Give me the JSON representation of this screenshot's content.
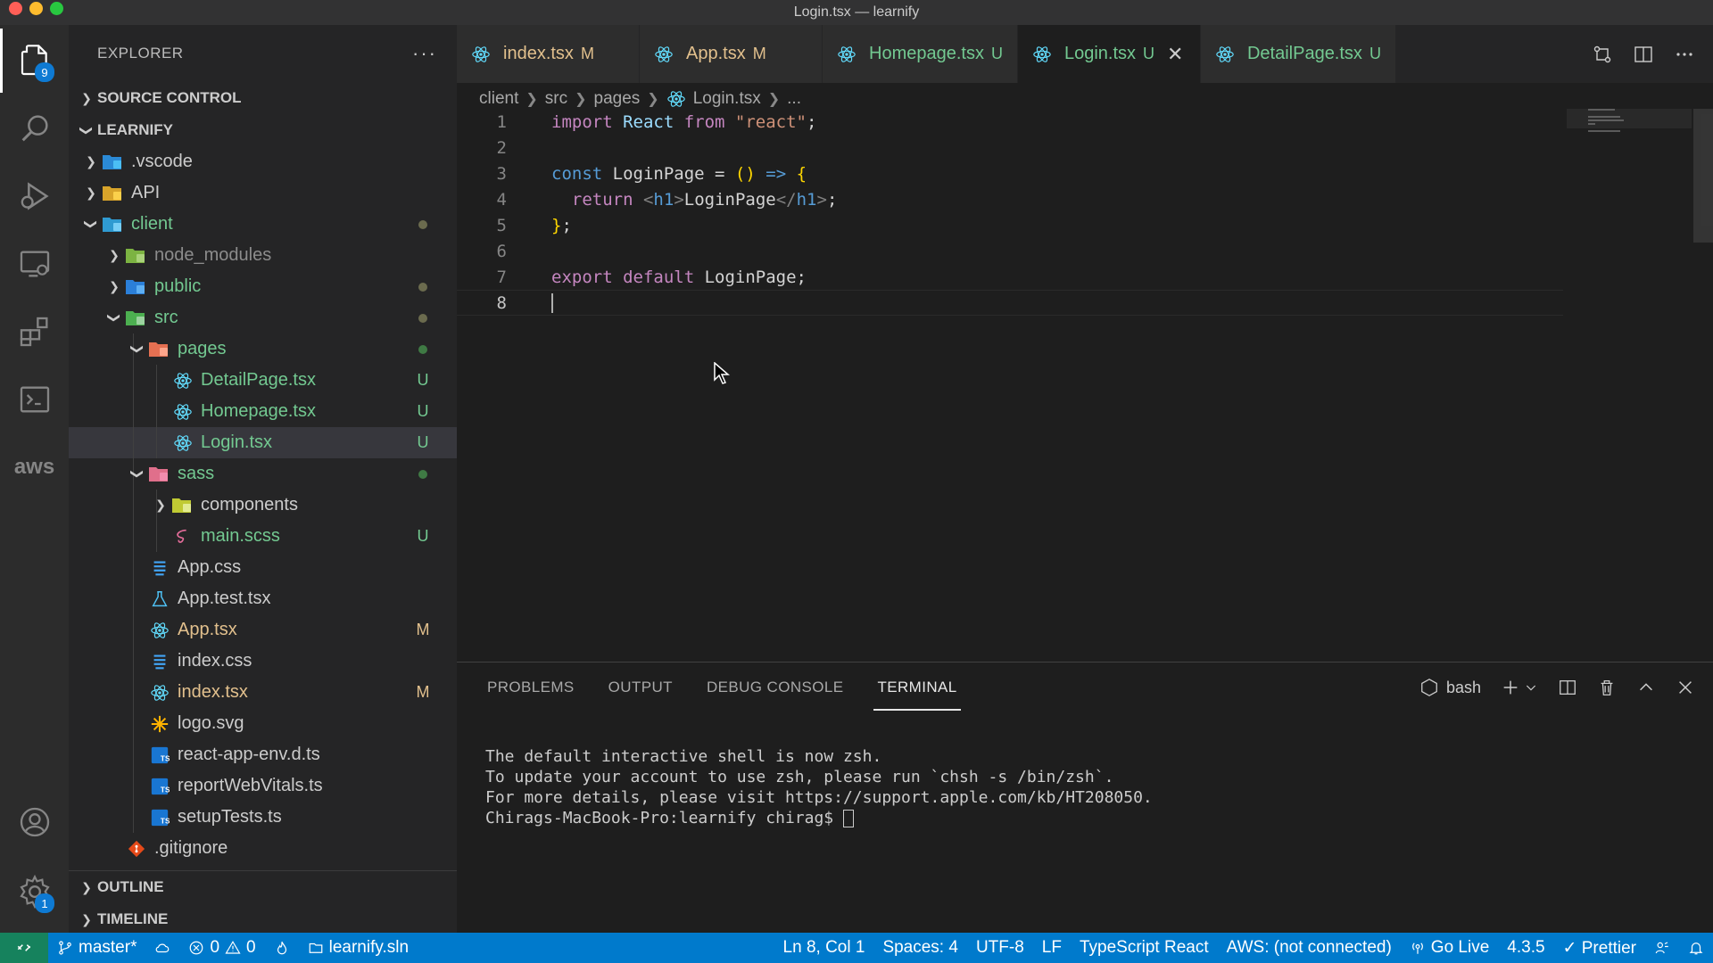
{
  "window": {
    "title": "Login.tsx — learnify"
  },
  "activity_bar": {
    "items": [
      {
        "name": "explorer",
        "badge": "9"
      },
      {
        "name": "search"
      },
      {
        "name": "run-debug"
      },
      {
        "name": "remote-explorer"
      },
      {
        "name": "extensions"
      },
      {
        "name": "terminal-view"
      },
      {
        "name": "aws",
        "label": "aws"
      }
    ],
    "accounts": {
      "name": "accounts"
    },
    "settings": {
      "name": "manage",
      "badge": "1"
    }
  },
  "sidebar": {
    "title": "EXPLORER",
    "more": "···",
    "source_control": "SOURCE CONTROL",
    "project": "LEARNIFY",
    "outline": "OUTLINE",
    "timeline": "TIMELINE",
    "tree": [
      {
        "label": ".vscode",
        "depth": 0,
        "type": "folder",
        "chevron": "right",
        "color": "default",
        "icon": "folder-vscode"
      },
      {
        "label": "API",
        "depth": 0,
        "type": "folder",
        "chevron": "right",
        "color": "default",
        "icon": "folder-api"
      },
      {
        "label": "client",
        "depth": 0,
        "type": "folder",
        "chevron": "down",
        "color": "untracked",
        "icon": "folder-client",
        "deco": "dot"
      },
      {
        "label": "node_modules",
        "depth": 1,
        "type": "folder",
        "chevron": "right",
        "color": "gray",
        "icon": "folder-node"
      },
      {
        "label": "public",
        "depth": 1,
        "type": "folder",
        "chevron": "right",
        "color": "untracked",
        "icon": "folder-public",
        "deco": "dot"
      },
      {
        "label": "src",
        "depth": 1,
        "type": "folder",
        "chevron": "down",
        "color": "untracked",
        "icon": "folder-src",
        "deco": "dot"
      },
      {
        "label": "pages",
        "depth": 2,
        "type": "folder",
        "chevron": "down",
        "color": "untracked",
        "icon": "folder-pages",
        "deco": "dot-green"
      },
      {
        "label": "DetailPage.tsx",
        "depth": 3,
        "type": "file",
        "color": "untracked",
        "icon": "react",
        "deco": "U"
      },
      {
        "label": "Homepage.tsx",
        "depth": 3,
        "type": "file",
        "color": "untracked",
        "icon": "react",
        "deco": "U"
      },
      {
        "label": "Login.tsx",
        "depth": 3,
        "type": "file",
        "color": "untracked",
        "icon": "react",
        "deco": "U",
        "selected": true
      },
      {
        "label": "sass",
        "depth": 2,
        "type": "folder",
        "chevron": "down",
        "color": "untracked",
        "icon": "folder-sass",
        "deco": "dot-green"
      },
      {
        "label": "components",
        "depth": 3,
        "type": "folder",
        "chevron": "right",
        "color": "default",
        "icon": "folder-components"
      },
      {
        "label": "main.scss",
        "depth": 3,
        "type": "file",
        "color": "untracked",
        "icon": "sass",
        "deco": "U"
      },
      {
        "label": "App.css",
        "depth": 2,
        "type": "file",
        "color": "default",
        "icon": "css"
      },
      {
        "label": "App.test.tsx",
        "depth": 2,
        "type": "file",
        "color": "default",
        "icon": "test"
      },
      {
        "label": "App.tsx",
        "depth": 2,
        "type": "file",
        "color": "modified",
        "icon": "react",
        "deco": "M"
      },
      {
        "label": "index.css",
        "depth": 2,
        "type": "file",
        "color": "default",
        "icon": "css"
      },
      {
        "label": "index.tsx",
        "depth": 2,
        "type": "file",
        "color": "modified",
        "icon": "react",
        "deco": "M"
      },
      {
        "label": "logo.svg",
        "depth": 2,
        "type": "file",
        "color": "default",
        "icon": "svg"
      },
      {
        "label": "react-app-env.d.ts",
        "depth": 2,
        "type": "file",
        "color": "default",
        "icon": "ts"
      },
      {
        "label": "reportWebVitals.ts",
        "depth": 2,
        "type": "file",
        "color": "default",
        "icon": "ts"
      },
      {
        "label": "setupTests.ts",
        "depth": 2,
        "type": "file",
        "color": "default",
        "icon": "ts"
      },
      {
        "label": ".gitignore",
        "depth": 1,
        "type": "file",
        "color": "default",
        "icon": "git"
      }
    ]
  },
  "tabs": [
    {
      "label": "index.tsx",
      "status": "M",
      "color": "modified",
      "active": false
    },
    {
      "label": "App.tsx",
      "status": "M",
      "color": "modified",
      "active": false
    },
    {
      "label": "Homepage.tsx",
      "status": "U",
      "color": "untracked",
      "active": false
    },
    {
      "label": "Login.tsx",
      "status": "U",
      "color": "untracked",
      "active": true
    },
    {
      "label": "DetailPage.tsx",
      "status": "U",
      "color": "untracked",
      "active": false
    }
  ],
  "breadcrumb": [
    "client",
    "src",
    "pages",
    "Login.tsx",
    "..."
  ],
  "editor": {
    "line_numbers": [
      "1",
      "2",
      "3",
      "4",
      "5",
      "6",
      "7",
      "8"
    ],
    "current_line": "8"
  },
  "code": {
    "l1_import": "import",
    "l1_react": " React ",
    "l1_from": "from",
    "l1_str": " \"react\"",
    "l1_semi": ";",
    "l3_const": "const",
    "l3_name": " LoginPage",
    "l3_eq": " = ",
    "l3_paren": "()",
    "l3_arrow": " => ",
    "l3_brace": "{",
    "l4_return": "return",
    "l4_open": " <",
    "l4_h1": "h1",
    "l4_gt": ">",
    "l4_text": "LoginPage",
    "l4_close": "</",
    "l4_h1b": "h1",
    "l4_gt2": ">",
    "l4_semi": ";",
    "l5_brace": "}",
    "l5_semi": ";",
    "l7_export": "export",
    "l7_default": " default",
    "l7_name": " LoginPage",
    "l7_semi": ";"
  },
  "panel": {
    "tabs": [
      "PROBLEMS",
      "OUTPUT",
      "DEBUG CONSOLE",
      "TERMINAL"
    ],
    "active_tab": "TERMINAL",
    "shell": "bash",
    "terminal_lines": [
      "The default interactive shell is now zsh.",
      "To update your account to use zsh, please run `chsh -s /bin/zsh`.",
      "For more details, please visit https://support.apple.com/kb/HT208050.",
      "Chirags-MacBook-Pro:learnify chirag$ "
    ]
  },
  "statusbar": {
    "branch": "master*",
    "errors": "0",
    "warnings": "0",
    "solution": "learnify.sln",
    "position": "Ln 8, Col 1",
    "spaces": "Spaces: 4",
    "encoding": "UTF-8",
    "eol": "LF",
    "language": "TypeScript React",
    "aws": "AWS: (not connected)",
    "golive": "Go Live",
    "version": "4.3.5",
    "prettier": "✓ Prettier"
  },
  "colors": {
    "accent": "#007acc",
    "untracked": "#73c991",
    "modified": "#e2c08d",
    "react": "#61dafb"
  }
}
